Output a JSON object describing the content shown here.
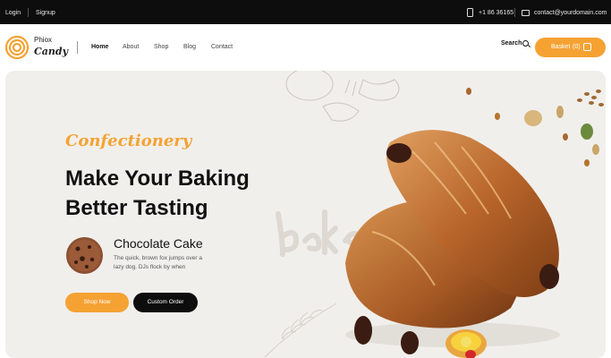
{
  "topbar": {
    "login": "Login",
    "signup": "Signup",
    "phone": "+1 86 36165",
    "email": "contact@yourdomain.com",
    "phone_icon": "phone-icon",
    "mail_icon": "mail-icon"
  },
  "brand": {
    "line1": "Phiox",
    "line2": "Candy",
    "accent_color": "#f5a233"
  },
  "nav": {
    "links": [
      "Home",
      "About",
      "Shop",
      "Blog",
      "Contact"
    ],
    "active": "Home",
    "search_label": "Search",
    "basket_label": "Basket",
    "basket_count": "(0)"
  },
  "hero": {
    "kicker": "Confectionery",
    "title": "Make Your Baking Better Tasting",
    "product_name": "Chocolate Cake",
    "product_desc": "The quick, brown fox jumps over a lazy dog. DJs flock by when",
    "primary_button": "Shop Now",
    "secondary_button": "Custom Order",
    "background_color": "#f1efec"
  }
}
